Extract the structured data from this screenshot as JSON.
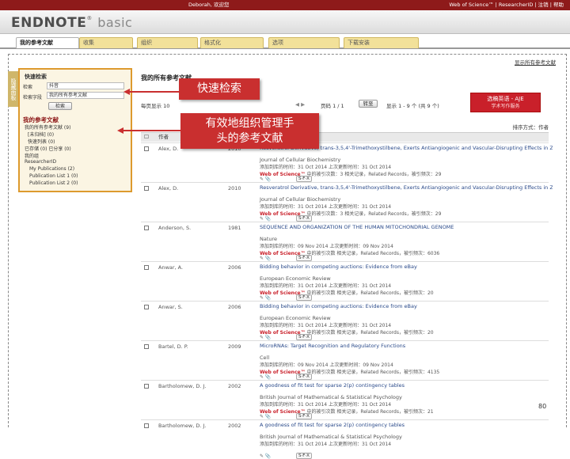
{
  "topbar": {
    "left": "Deborah, 欢迎您",
    "right": "Web of Science™  |  ResearcherID  |  注销  |  帮助"
  },
  "brand": {
    "name": "ENDNOTE",
    "suffix": "basic"
  },
  "tabs": [
    {
      "label": "我的参考文献"
    },
    {
      "label": "收集"
    },
    {
      "label": "组织"
    },
    {
      "label": "格式化"
    },
    {
      "label": "选项"
    },
    {
      "label": "下载安装"
    }
  ],
  "side_strip": "隐藏面板",
  "quick_search": {
    "header": "快速检索",
    "label_for": "检索",
    "value": "抖音",
    "label_in": "检索字段",
    "scope": "我的所有参考文献",
    "button": "检索"
  },
  "my_references": {
    "header": "我的参考文献",
    "items": [
      "我的所有参考文献 (9)",
      "[未归档] (0)",
      "快速列表 (0)",
      "已存储 (0) 已分享 (0)",
      "我的组",
      "ResearcherID",
      "My Publications (2)",
      "Publication List 1 (0)",
      "Publication List 2 (0)"
    ]
  },
  "main": {
    "title": "我的所有参考文献",
    "top_link": "显示所有参考文献",
    "count_label": "每页显示 10",
    "page_label": "页码 1 / 1",
    "go_button": "转至",
    "range_label": "显示 1 - 9 个 (共 9 个)",
    "sort_label": "排序方式：作者",
    "col_header": "作者"
  },
  "ad": {
    "line1": "选稿英语 - AJE",
    "line2": "学术写作服务"
  },
  "callouts": {
    "quick": "快速检索",
    "org_line1": "有效地组织管理手",
    "org_line2": "头的参考文献"
  },
  "references": [
    {
      "author": "Alex, D.",
      "year": "2010",
      "title": "Resveratrol Derivative, trans-3,5,4'-Trimethoxystilbene, Exerts Antiangiogenic and Vascular-Disrupting Effects in Zebrafish through the Downregulation of VEGFR2 and Cell-Cycle Modulation",
      "journal": "Journal of Cellular Biochemistry",
      "added": "添加到库的时间：31 Oct 2014     上次更新时间：31 Oct 2014",
      "cited_wos": "Web of Science™",
      "cited_rest": "中的被引次数：3   相关记录，Related Records，被引频次：29"
    },
    {
      "author": "Alex, D.",
      "year": "2010",
      "title": "Resveratrol Derivative, trans-3,5,4'-Trimethoxystilbene, Exerts Antiangiogenic and Vascular-Disrupting Effects in Zebrafish through the Downregulation of VEGFR2 and Cell-Cycle Modulation",
      "journal": "Journal of Cellular Biochemistry",
      "added": "添加到库的时间：31 Oct 2014     上次更新时间：31 Oct 2014",
      "cited_wos": "Web of Science™",
      "cited_rest": "中的被引次数：3   相关记录，Related Records，被引频次：29"
    },
    {
      "author": "Anderson, S.",
      "year": "1981",
      "title": "SEQUENCE AND ORGANIZATION OF THE HUMAN MITOCHONDRIAL GENOME",
      "journal": "Nature",
      "added": "添加到库的时间：09 Nov 2014     上次更新时间：09 Nov 2014",
      "cited_wos": "Web of Science™",
      "cited_rest": "中的被引次数   相关记录，Related Records，被引频次：6036"
    },
    {
      "author": "Anwar, A.",
      "year": "2006",
      "title": "Bidding behavior in competing auctions: Evidence from eBay",
      "journal": "European Economic Review",
      "added": "添加到库的时间：31 Oct 2014     上次更新时间：31 Oct 2014",
      "cited_wos": "Web of Science™",
      "cited_rest": "中的被引次数   相关记录，Related Records，被引频次：20"
    },
    {
      "author": "Anwar, S.",
      "year": "2006",
      "title": "Bidding behavior in competing auctions: Evidence from eBay",
      "journal": "European Economic Review",
      "added": "添加到库的时间：31 Oct 2014     上次更新时间：31 Oct 2014",
      "cited_wos": "Web of Science™",
      "cited_rest": "中的被引次数   相关记录，Related Records，被引频次：20"
    },
    {
      "author": "Bartel, D. P.",
      "year": "2009",
      "title": "MicroRNAs: Target Recognition and Regulatory Functions",
      "journal": "Cell",
      "added": "添加到库的时间：09 Nov 2014     上次更新时间：09 Nov 2014",
      "cited_wos": "Web of Science™",
      "cited_rest": "中的被引次数   相关记录，Related Records，被引频次：4135"
    },
    {
      "author": "Bartholomew, D. J.",
      "year": "2002",
      "title": "A goodness of fit test for sparse 2(p) contingency tables",
      "journal": "British Journal of Mathematical & Statistical Psychology",
      "added": "添加到库的时间：31 Oct 2014     上次更新时间：31 Oct 2014",
      "cited_wos": "Web of Science™",
      "cited_rest": "中的被引次数   相关记录，Related Records，被引频次：21"
    },
    {
      "author": "Bartholomew, D. J.",
      "year": "2002",
      "title": "A goodness of fit test for sparse 2(p) contingency tables",
      "journal": "British Journal of Mathematical & Statistical Psychology",
      "added": "添加到库的时间：31 Oct 2014     上次更新时间：31 Oct 2014",
      "cited_wos": "",
      "cited_rest": ""
    }
  ],
  "page_number": "80"
}
